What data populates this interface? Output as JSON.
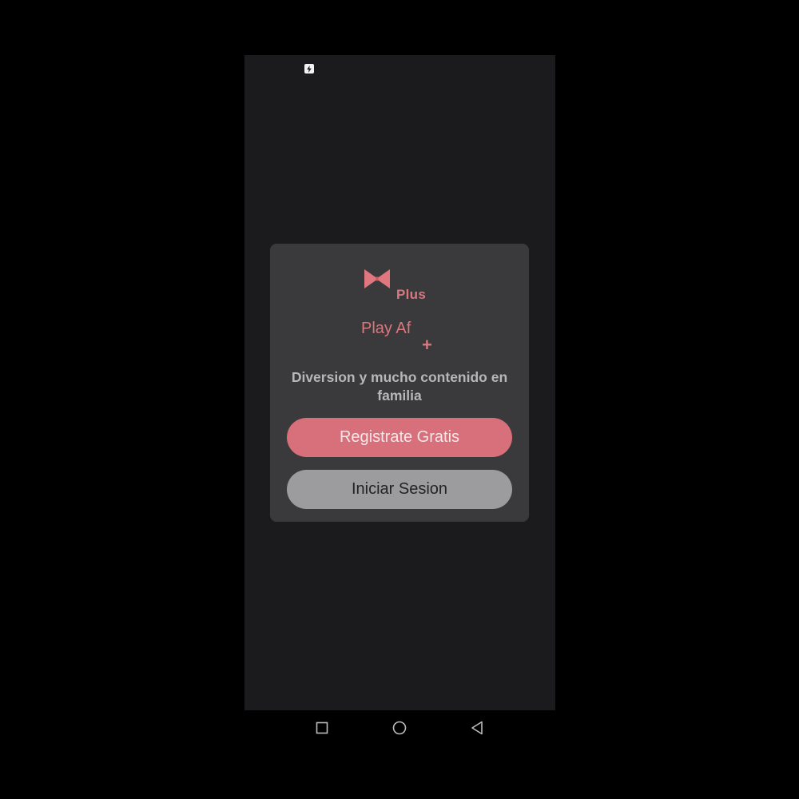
{
  "status_bar": {
    "notification_icon": "app-notification-icon"
  },
  "card": {
    "logo_icon": "bow-logo-icon",
    "logo_plus": "Plus",
    "app_name": "Play Af",
    "app_plus_sign": "+",
    "tagline": "Diversion y mucho contenido en familia",
    "register_label": "Registrate Gratis",
    "login_label": "Iniciar Sesion"
  },
  "nav_bar": {
    "recents_icon": "square-icon",
    "home_icon": "circle-icon",
    "back_icon": "triangle-back-icon"
  },
  "colors": {
    "accent": "#d7707a",
    "card_bg": "#3a393b",
    "screen_bg": "#1b1a1c",
    "secondary_button": "#9c9b9e"
  }
}
